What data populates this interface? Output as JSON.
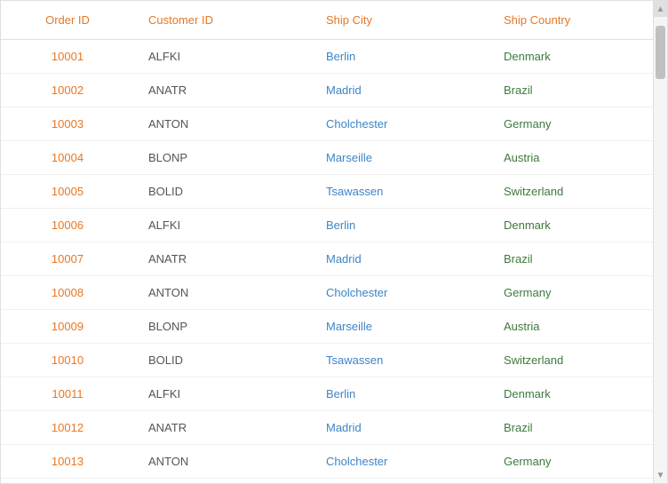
{
  "table": {
    "columns": [
      {
        "key": "order_id",
        "label": "Order ID"
      },
      {
        "key": "customer_id",
        "label": "Customer ID"
      },
      {
        "key": "ship_city",
        "label": "Ship City"
      },
      {
        "key": "ship_country",
        "label": "Ship Country"
      }
    ],
    "rows": [
      {
        "order_id": "10001",
        "customer_id": "ALFKI",
        "ship_city": "Berlin",
        "ship_country": "Denmark"
      },
      {
        "order_id": "10002",
        "customer_id": "ANATR",
        "ship_city": "Madrid",
        "ship_country": "Brazil"
      },
      {
        "order_id": "10003",
        "customer_id": "ANTON",
        "ship_city": "Cholchester",
        "ship_country": "Germany"
      },
      {
        "order_id": "10004",
        "customer_id": "BLONP",
        "ship_city": "Marseille",
        "ship_country": "Austria"
      },
      {
        "order_id": "10005",
        "customer_id": "BOLID",
        "ship_city": "Tsawassen",
        "ship_country": "Switzerland"
      },
      {
        "order_id": "10006",
        "customer_id": "ALFKI",
        "ship_city": "Berlin",
        "ship_country": "Denmark"
      },
      {
        "order_id": "10007",
        "customer_id": "ANATR",
        "ship_city": "Madrid",
        "ship_country": "Brazil"
      },
      {
        "order_id": "10008",
        "customer_id": "ANTON",
        "ship_city": "Cholchester",
        "ship_country": "Germany"
      },
      {
        "order_id": "10009",
        "customer_id": "BLONP",
        "ship_city": "Marseille",
        "ship_country": "Austria"
      },
      {
        "order_id": "10010",
        "customer_id": "BOLID",
        "ship_city": "Tsawassen",
        "ship_country": "Switzerland"
      },
      {
        "order_id": "10011",
        "customer_id": "ALFKI",
        "ship_city": "Berlin",
        "ship_country": "Denmark"
      },
      {
        "order_id": "10012",
        "customer_id": "ANATR",
        "ship_city": "Madrid",
        "ship_country": "Brazil"
      },
      {
        "order_id": "10013",
        "customer_id": "ANTON",
        "ship_city": "Cholchester",
        "ship_country": "Germany"
      }
    ]
  },
  "scrollbar": {
    "up_arrow": "▲",
    "down_arrow": "▼"
  }
}
